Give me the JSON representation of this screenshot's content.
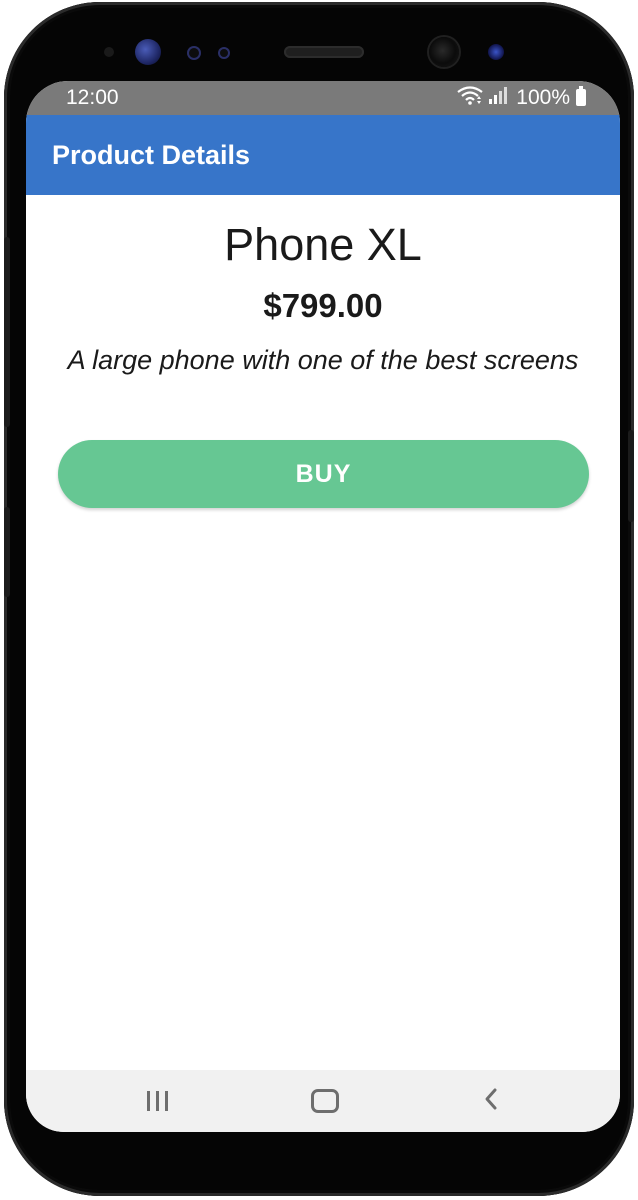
{
  "status_bar": {
    "time": "12:00",
    "battery_percent": "100%",
    "icons": [
      "wifi-icon",
      "signal-icon",
      "battery-icon"
    ]
  },
  "app_bar": {
    "title": "Product Details",
    "color": "#3775c9"
  },
  "product": {
    "name": "Phone XL",
    "price": "$799.00",
    "description": "A large phone with one of the best screens"
  },
  "buy_button": {
    "label": "BUY",
    "color": "#66c793"
  },
  "nav_bar": {
    "icons": [
      "recent-apps-icon",
      "home-icon",
      "back-icon"
    ]
  }
}
